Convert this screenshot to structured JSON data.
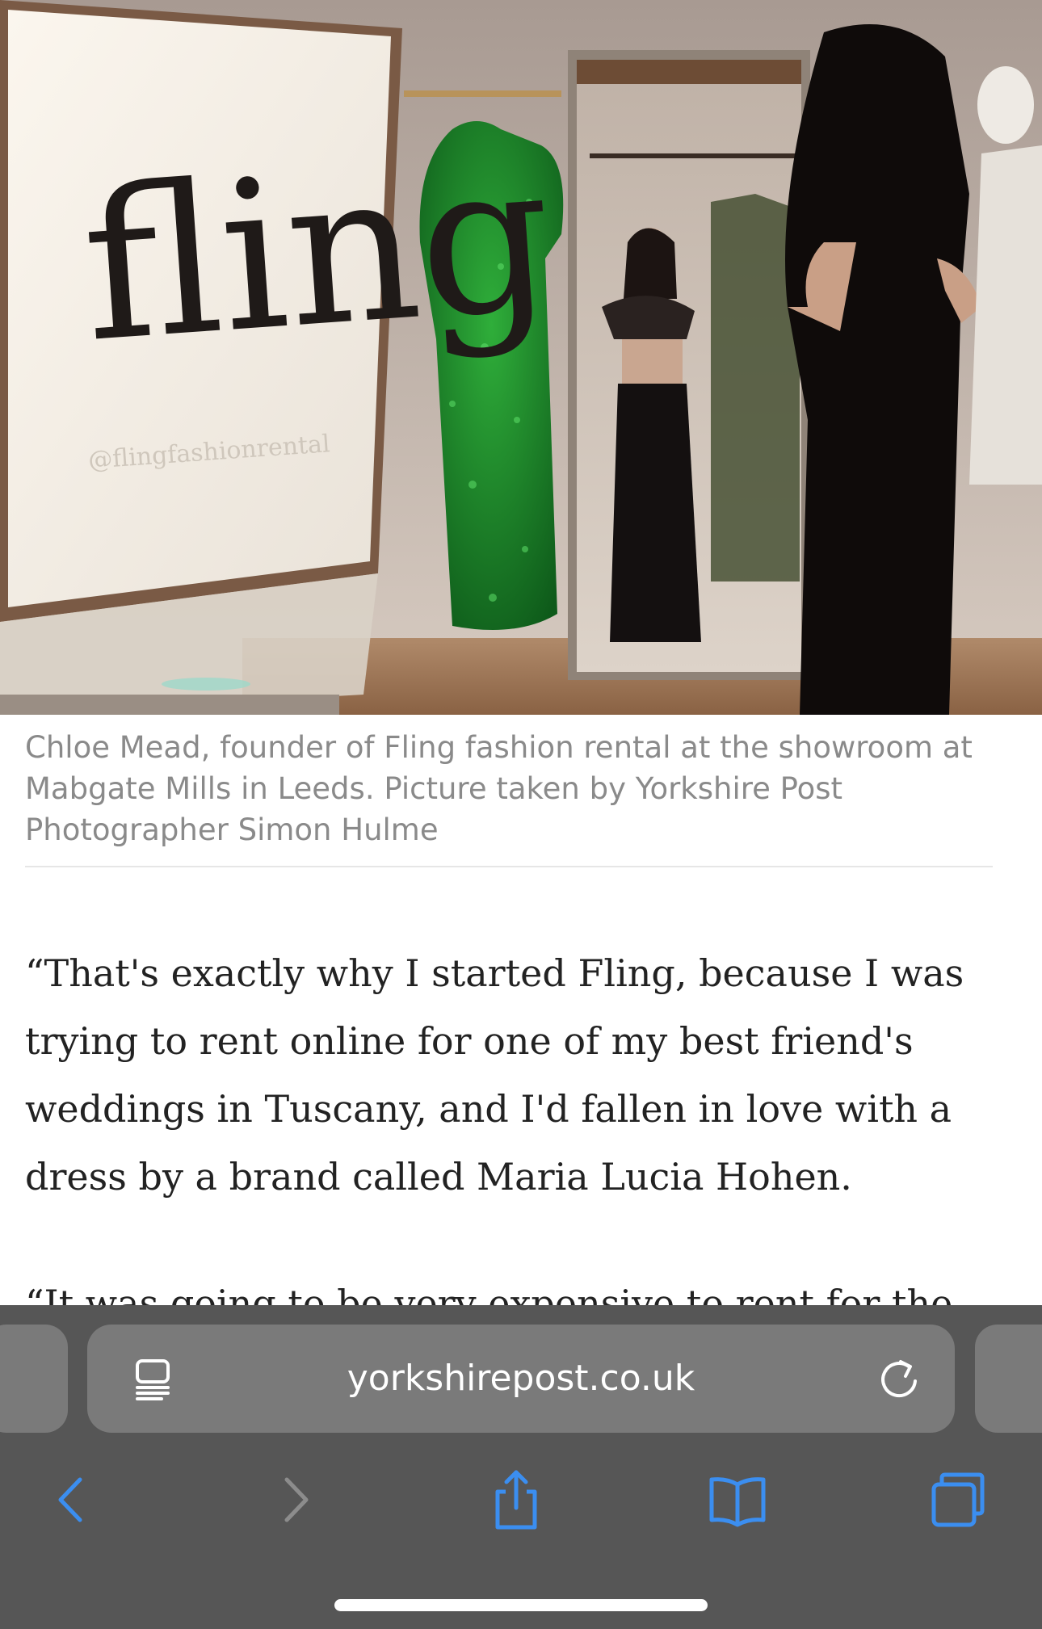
{
  "photo": {
    "sign_text": "fling",
    "sign_handle": "@flingfashionrental"
  },
  "caption": "Chloe Mead, founder of Fling fashion rental at the showroom at Mabgate Mills in Leeds. Picture taken by Yorkshire Post Photographer Simon Hulme",
  "article": {
    "paragraph1": "“That's exactly why I started Fling, because I was trying to rent online for one of my best friend's weddings in Tuscany, and I'd fallen in love with a dress by a brand called Maria Lucia Hohen.",
    "paragraph2": "“It was going to be very expensive to rent for the"
  },
  "browser": {
    "url": "yorkshirepost.co.uk",
    "icons": {
      "reader": "reader-mode-icon",
      "reload": "reload-icon",
      "back": "chevron-left-icon",
      "forward": "chevron-right-icon",
      "share": "share-icon",
      "bookmarks": "book-icon",
      "tabs": "tabs-icon"
    },
    "colors": {
      "accent": "#3b8ef0",
      "toolbar": "#565656",
      "urlbar": "#7a7a7a",
      "disabled": "#8c8c8c"
    }
  }
}
